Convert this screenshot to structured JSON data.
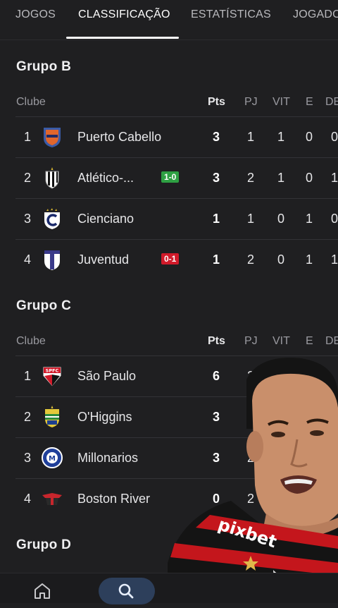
{
  "tabs": [
    "JOGOS",
    "CLASSIFICAÇÃO",
    "ESTATÍSTICAS",
    "JOGADO"
  ],
  "table_headers": {
    "club": "Clube",
    "pts": "Pts",
    "pj": "PJ",
    "vit": "VIT",
    "e": "E",
    "de": "DE"
  },
  "groups": [
    {
      "title": "Grupo B",
      "rows": [
        {
          "pos": "1",
          "name": "Puerto Cabello",
          "pts": "3",
          "pj": "1",
          "vit": "1",
          "e": "0",
          "de": "0",
          "badge": ""
        },
        {
          "pos": "2",
          "name": "Atlético-...",
          "pts": "3",
          "pj": "2",
          "vit": "1",
          "e": "0",
          "de": "1",
          "badge": "1-0"
        },
        {
          "pos": "3",
          "name": "Cienciano",
          "pts": "1",
          "pj": "1",
          "vit": "0",
          "e": "1",
          "de": "0",
          "badge": ""
        },
        {
          "pos": "4",
          "name": "Juventud",
          "pts": "1",
          "pj": "2",
          "vit": "0",
          "e": "1",
          "de": "1",
          "badge": "0-1"
        }
      ]
    },
    {
      "title": "Grupo C",
      "rows": [
        {
          "pos": "1",
          "name": "São Paulo",
          "pts": "6",
          "pj": "2",
          "vit": "",
          "e": "",
          "de": "",
          "badge": ""
        },
        {
          "pos": "2",
          "name": "O'Higgins",
          "pts": "3",
          "pj": "",
          "vit": "",
          "e": "",
          "de": "",
          "badge": ""
        },
        {
          "pos": "3",
          "name": "Millonarios",
          "pts": "3",
          "pj": "2",
          "vit": "",
          "e": "",
          "de": "",
          "badge": ""
        },
        {
          "pos": "4",
          "name": "Boston River",
          "pts": "0",
          "pj": "2",
          "vit": "",
          "e": "",
          "de": "",
          "badge": ""
        }
      ]
    },
    {
      "title": "Grupo D"
    }
  ],
  "colors": {
    "win_badge": "#2ea043",
    "loss_badge": "#d11a2a",
    "nav_active": "#2d3f5b"
  },
  "nav_icons": [
    "home-icon",
    "search-icon"
  ]
}
